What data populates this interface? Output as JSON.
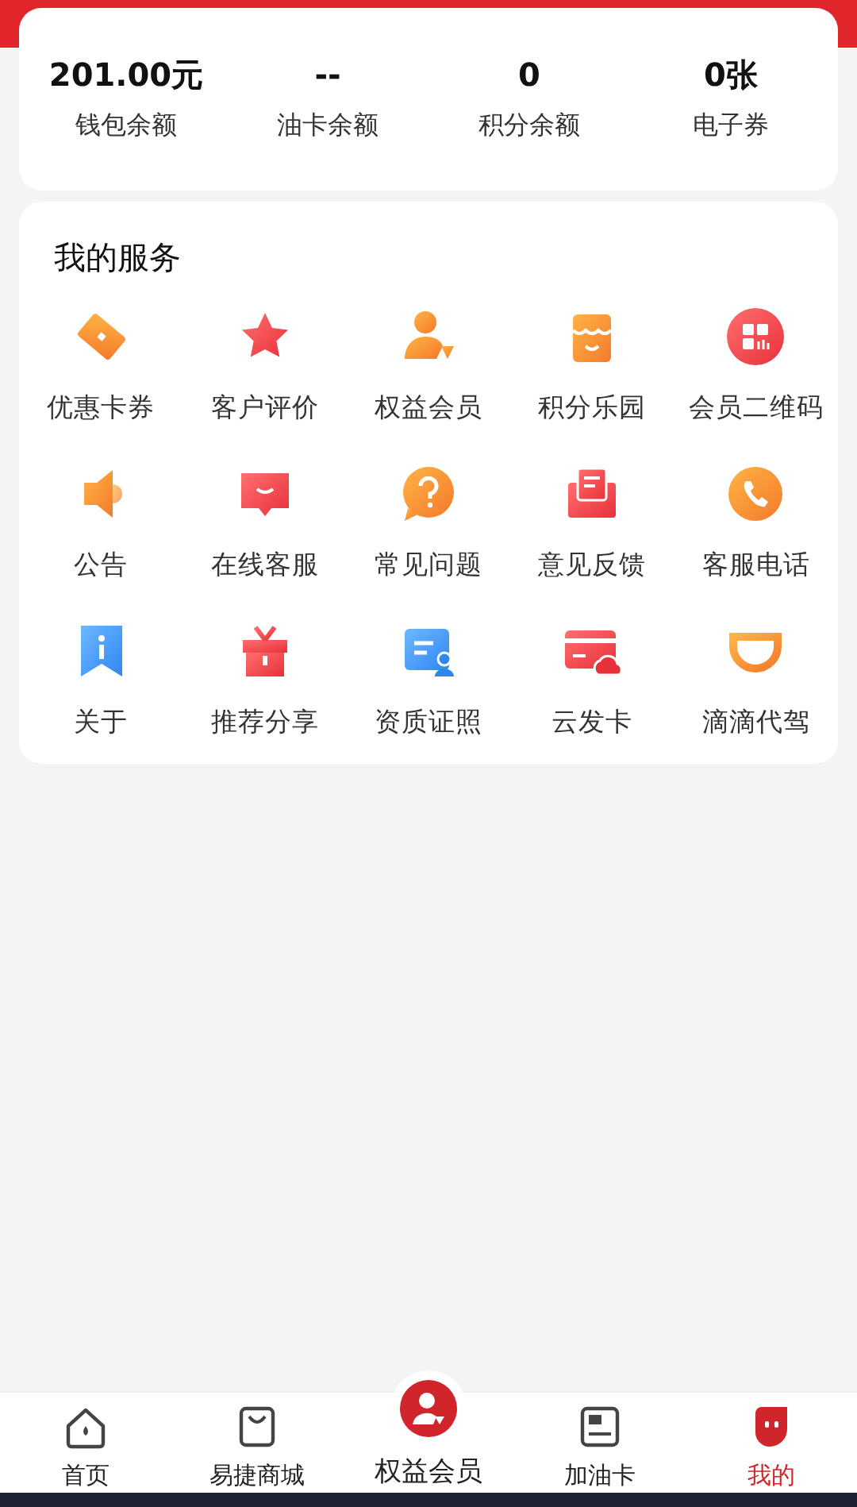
{
  "summary": [
    {
      "value": "201.00元",
      "label": "钱包余额"
    },
    {
      "value": "--",
      "label": "油卡余额"
    },
    {
      "value": "0",
      "label": "积分余额"
    },
    {
      "value": "0张",
      "label": "电子券"
    }
  ],
  "services": {
    "title": "我的服务",
    "items": [
      {
        "label": "优惠卡券"
      },
      {
        "label": "客户评价"
      },
      {
        "label": "权益会员"
      },
      {
        "label": "积分乐园"
      },
      {
        "label": "会员二维码"
      },
      {
        "label": "公告"
      },
      {
        "label": "在线客服"
      },
      {
        "label": "常见问题"
      },
      {
        "label": "意见反馈"
      },
      {
        "label": "客服电话"
      },
      {
        "label": "关于"
      },
      {
        "label": "推荐分享"
      },
      {
        "label": "资质证照"
      },
      {
        "label": "云发卡"
      },
      {
        "label": "滴滴代驾"
      }
    ]
  },
  "tab_bar": [
    {
      "label": "首页",
      "kind": "tab",
      "selected": false
    },
    {
      "label": "易捷商城",
      "kind": "tab",
      "selected": false
    },
    {
      "label": "权益会员",
      "kind": "featured",
      "selected": false
    },
    {
      "label": "加油卡",
      "kind": "tab",
      "selected": false
    },
    {
      "label": "我的",
      "kind": "tab",
      "selected": true
    }
  ]
}
